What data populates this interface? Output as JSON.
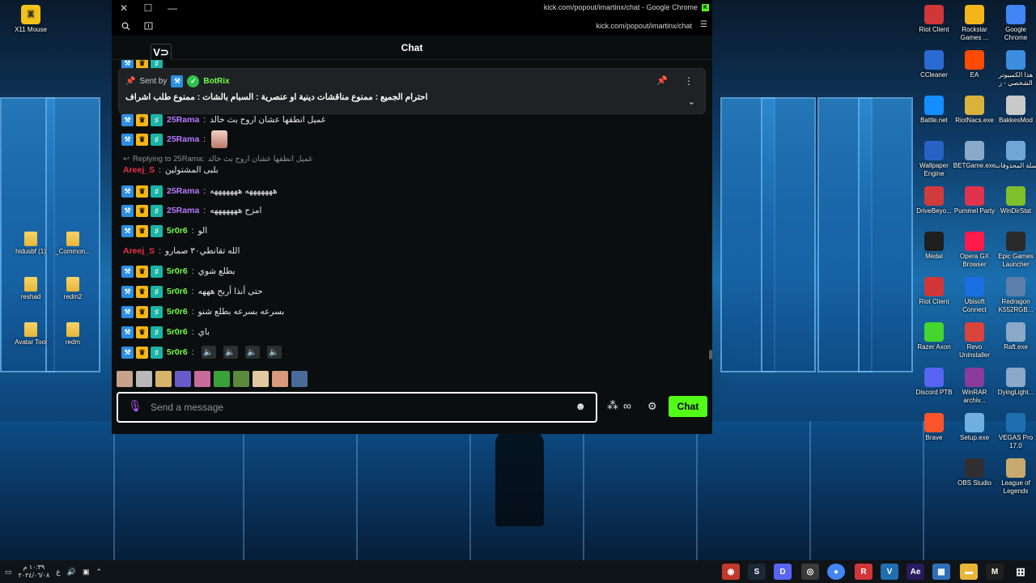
{
  "window": {
    "title": "kick.com/popout/imartinx/chat - Google Chrome",
    "url": "kick.com/popout/imartinx/chat",
    "header": "Chat"
  },
  "pinned": {
    "sent_by_label": "Sent by",
    "author": "BotRix",
    "text": "احترام الجميع : ممنوع مناقشات دينية او عنصرية : السبام بالشات : ممنوع طلب اشراف"
  },
  "messages": [
    {
      "user": "25Rama",
      "text": "غميل انطقها عشان اروح بث خالد",
      "color": "purple"
    },
    {
      "user": "25Rama",
      "text": "",
      "color": "purple"
    },
    {
      "user": "Areej_S",
      "text": "بلبى المشتولين",
      "color": "red"
    },
    {
      "user": "25Rama",
      "text": "هههههههه هههههههه",
      "color": "purple"
    },
    {
      "user": "25Rama",
      "text": "امزح هههههههه",
      "color": "purple"
    },
    {
      "user": "5r0r6",
      "text": "الو",
      "color": "green"
    },
    {
      "user": "Areej_S",
      "text": "الله تقانطي٣٠ صمارو",
      "color": "red"
    },
    {
      "user": "5r0r6",
      "text": "بطلع شوي",
      "color": "green"
    },
    {
      "user": "5r0r6",
      "text": "حتى أنذا أربح هههه",
      "color": "green"
    },
    {
      "user": "5r0r6",
      "text": "بسرعه بسرعه بطلع شنو",
      "color": "green"
    },
    {
      "user": "5r0r6",
      "text": "باي",
      "color": "green"
    },
    {
      "user": "5r0r6",
      "text": "",
      "color": "green"
    }
  ],
  "reply": {
    "label": "Replying to 25Rama:",
    "quote": "غميل انطقها عشان اروح بث خالد"
  },
  "composer": {
    "placeholder": "Send a message",
    "send_label": "Chat"
  },
  "desktop_icons_right": [
    {
      "label": "Riot Client",
      "color": "#d13639"
    },
    {
      "label": "Rockstar Games ...",
      "color": "#f2b51a"
    },
    {
      "label": "Google Chrome",
      "color": "#4285f4"
    },
    {
      "label": "CCleaner",
      "color": "#2b6bd1"
    },
    {
      "label": "EA",
      "color": "#ff4a00"
    },
    {
      "label": "هذا الكمبيوتر الشخصي - ز",
      "color": "#3d8de0"
    },
    {
      "label": "Battle.net",
      "color": "#148eff"
    },
    {
      "label": "RiotNacs.exe",
      "color": "#d9b23c"
    },
    {
      "label": "BakkesMod",
      "color": "#c9c9c9"
    },
    {
      "label": "Wallpaper Engine",
      "color": "#2862c4"
    },
    {
      "label": "BETGame.exe",
      "color": "#8aa8c8"
    },
    {
      "label": "سلة المحذوفات",
      "color": "#6fa6d8"
    },
    {
      "label": "DriveBeyo...",
      "color": "#d13b3b"
    },
    {
      "label": "Pummel Party",
      "color": "#e0344c"
    },
    {
      "label": "WinDirStat",
      "color": "#7fbf2a"
    },
    {
      "label": "Medal",
      "color": "#1f1f1f"
    },
    {
      "label": "Opera GX Browser",
      "color": "#ff1b4a"
    },
    {
      "label": "Epic Games Launcher",
      "color": "#2a2a2a"
    },
    {
      "label": "Riot Client",
      "color": "#d13639"
    },
    {
      "label": "Ubisoft Connect",
      "color": "#1a6fe0"
    },
    {
      "label": "Redragon K552RGB...",
      "color": "#5b7fa8"
    },
    {
      "label": "Razer Axon",
      "color": "#44d62c"
    },
    {
      "label": "Revo Uninstaller",
      "color": "#d9433b"
    },
    {
      "label": "Raft.exe",
      "color": "#8aa8c8"
    },
    {
      "label": "Discord PTB",
      "color": "#5865f2"
    },
    {
      "label": "WinRAR archiv...",
      "color": "#8a3b9c"
    },
    {
      "label": "DyingLight...",
      "color": "#8aa8c8"
    },
    {
      "label": "Brave",
      "color": "#fb542b"
    },
    {
      "label": "Setup.exe",
      "color": "#6fb0e0"
    },
    {
      "label": "VEGAS Pro 17.0",
      "color": "#1f6fb0"
    },
    {
      "label": "OBS Studio",
      "color": "#302e31"
    },
    {
      "label": "League of Legends",
      "color": "#c8aa6e"
    }
  ],
  "desktop_icons_left": [
    {
      "label": "X11 Mouse"
    },
    {
      "label": "hidusbf (1)"
    },
    {
      "label": "_Common..."
    },
    {
      "label": "reshad"
    },
    {
      "label": "redm2"
    },
    {
      "label": "Avatar Tool"
    },
    {
      "label": "redm"
    }
  ],
  "taskbar": {
    "clock_time": "١٠:٣٩ م",
    "clock_date": "٢٠٢٤/٠٦/٠٨",
    "lang": "ع"
  }
}
